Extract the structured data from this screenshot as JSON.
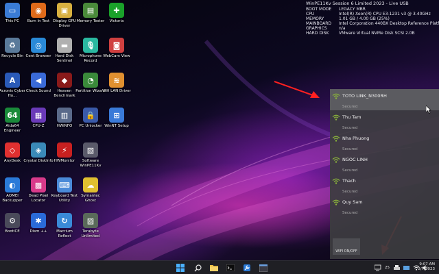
{
  "desktop_icons": [
    {
      "label": "This PC",
      "col": 0,
      "row": 0,
      "color": "#3a7bd5",
      "glyph": "▭",
      "icon": "monitor-icon"
    },
    {
      "label": "Burn In Test",
      "col": 1,
      "row": 0,
      "color": "#e06a1a",
      "glyph": "◉",
      "icon": "flame-icon"
    },
    {
      "label": "Display GPU Driver",
      "col": 2,
      "row": 0,
      "color": "#d8b040",
      "glyph": "▣",
      "icon": "gpu-icon"
    },
    {
      "label": "Memory Tester",
      "col": 3,
      "row": 0,
      "color": "#4a8a3a",
      "glyph": "▤",
      "icon": "memory-icon"
    },
    {
      "label": "Victoria",
      "col": 4,
      "row": 0,
      "color": "#1aa12a",
      "glyph": "✚",
      "icon": "green-cross-icon"
    },
    {
      "label": "Recycle Bin",
      "col": 0,
      "row": 1,
      "color": "#5a7a9a",
      "glyph": "♻",
      "icon": "recycle-bin-icon"
    },
    {
      "label": "Cent Browser",
      "col": 1,
      "row": 1,
      "color": "#2a8ad8",
      "glyph": "◎",
      "icon": "browser-icon"
    },
    {
      "label": "Hard Disk Sentinel",
      "col": 2,
      "row": 1,
      "color": "#b0b0b0",
      "glyph": "▬",
      "icon": "hard-disk-icon"
    },
    {
      "label": "Microphone Record",
      "col": 3,
      "row": 1,
      "color": "#2ab8a0",
      "glyph": "🎙",
      "icon": "microphone-icon"
    },
    {
      "label": "WebCam View",
      "col": 4,
      "row": 1,
      "color": "#d04040",
      "glyph": "◙",
      "icon": "webcam-icon"
    },
    {
      "label": "Acronis Cyber Ho...",
      "col": 0,
      "row": 2,
      "color": "#2a5ab8",
      "glyph": "A",
      "icon": "acronis-icon"
    },
    {
      "label": "Check Sound",
      "col": 1,
      "row": 2,
      "color": "#3a6ad8",
      "glyph": "◀",
      "icon": "speaker-icon"
    },
    {
      "label": "Heaven Benchmark",
      "col": 2,
      "row": 2,
      "color": "#8a1a1a",
      "glyph": "◆",
      "icon": "heaven-icon"
    },
    {
      "label": "Partition Wizard",
      "col": 3,
      "row": 2,
      "color": "#3a8a3a",
      "glyph": "◔",
      "icon": "partition-icon"
    },
    {
      "label": "Wifi LAN Driver",
      "col": 4,
      "row": 2,
      "color": "#e09030",
      "glyph": "≋",
      "icon": "wifi-driver-icon"
    },
    {
      "label": "Aida64 Engineer",
      "col": 0,
      "row": 3,
      "color": "#1a8a3a",
      "glyph": "64",
      "icon": "aida64-icon"
    },
    {
      "label": "CPU-Z",
      "col": 1,
      "row": 3,
      "color": "#6a3ab8",
      "glyph": "▦",
      "icon": "cpu-icon"
    },
    {
      "label": "HWiNFO",
      "col": 2,
      "row": 3,
      "color": "#5a6a8a",
      "glyph": "▥",
      "icon": "hwinfo-icon"
    },
    {
      "label": "PC Unlocker",
      "col": 3,
      "row": 3,
      "color": "#3a5aa8",
      "glyph": "🔒",
      "icon": "lock-icon"
    },
    {
      "label": "WinNT Setup",
      "col": 4,
      "row": 3,
      "color": "#3a7ad8",
      "glyph": "⊞",
      "icon": "windows-setup-icon"
    },
    {
      "label": "AnyDesk",
      "col": 0,
      "row": 4,
      "color": "#e03030",
      "glyph": "◇",
      "icon": "anydesk-icon"
    },
    {
      "label": "Crystal DiskInfo",
      "col": 1,
      "row": 4,
      "color": "#3a8ab8",
      "glyph": "◈",
      "icon": "crystal-icon"
    },
    {
      "label": "HWMonitor",
      "col": 2,
      "row": 4,
      "color": "#c82020",
      "glyph": "⚡",
      "icon": "hwmonitor-icon"
    },
    {
      "label": "Software WinPE11Kv",
      "col": 3,
      "row": 4,
      "color": "#5a5a6a",
      "glyph": "▧",
      "icon": "software-icon"
    },
    {
      "label": "AOMEI Backupper",
      "col": 0,
      "row": 5,
      "color": "#2a7ad8",
      "glyph": "◐",
      "icon": "backup-icon"
    },
    {
      "label": "Dead Pixel Locator",
      "col": 1,
      "row": 5,
      "color": "#d83a8a",
      "glyph": "▩",
      "icon": "dead-pixel-icon"
    },
    {
      "label": "Keyboard Test Utility",
      "col": 2,
      "row": 5,
      "color": "#4a8ad8",
      "glyph": "⌨",
      "icon": "keyboard-icon"
    },
    {
      "label": "Symantec Ghost",
      "col": 3,
      "row": 5,
      "color": "#e0c030",
      "glyph": "☁",
      "icon": "ghost-icon"
    },
    {
      "label": "BootICE",
      "col": 0,
      "row": 6,
      "color": "#4a4a5a",
      "glyph": "⚙",
      "icon": "bootice-icon"
    },
    {
      "label": "Dism ++",
      "col": 1,
      "row": 6,
      "color": "#2a6ad8",
      "glyph": "✱",
      "icon": "gears-icon"
    },
    {
      "label": "Macrium Reflect",
      "col": 2,
      "row": 6,
      "color": "#3a8ad8",
      "glyph": "↻",
      "icon": "macrium-icon"
    },
    {
      "label": "Terabyte Unlimited",
      "col": 3,
      "row": 6,
      "color": "#5a6a5a",
      "glyph": "▨",
      "icon": "terabyte-icon"
    }
  ],
  "sysinfo": {
    "title": "WinPE11Kv Session 6 Limited 2023 - Live USB",
    "rows": [
      {
        "k": "BOOT MODE",
        "v": "LEGACY MBR"
      },
      {
        "k": "CPU",
        "v": "Intel(R) Xeon(R) CPU E3-1231 v3 @ 3.40GHz"
      },
      {
        "k": "MEMORY",
        "v": "1.01 GB / 4.00 GB (25%)"
      },
      {
        "k": "MAINBOARD",
        "v": "Intel Corporation 440BX Desktop Reference Platform"
      },
      {
        "k": "GRAPHICS",
        "v": "n/a"
      },
      {
        "k": "HARD DISK",
        "v": "VMware Virtual NVMe Disk SCSI 2.0B"
      }
    ]
  },
  "wifi_panel": {
    "networks": [
      {
        "name": "TOTO LINK_N300RH",
        "status": "Secured",
        "selected": true
      },
      {
        "name": "Thu Tam",
        "status": "Secured",
        "selected": false
      },
      {
        "name": "Nha Phuong",
        "status": "Secured",
        "selected": false
      },
      {
        "name": "NGOC LINH",
        "status": "Secured",
        "selected": false
      },
      {
        "name": "Thach",
        "status": "Secured",
        "selected": false
      },
      {
        "name": "Quy Sam",
        "status": "Secured",
        "selected": false
      }
    ],
    "toggle_label": "WIFI ON/OFF",
    "signal_color": "#8ab43a"
  },
  "taskbar": {
    "time": "9:07 AM",
    "date": "2/7/2023",
    "tray_badge": "25"
  }
}
